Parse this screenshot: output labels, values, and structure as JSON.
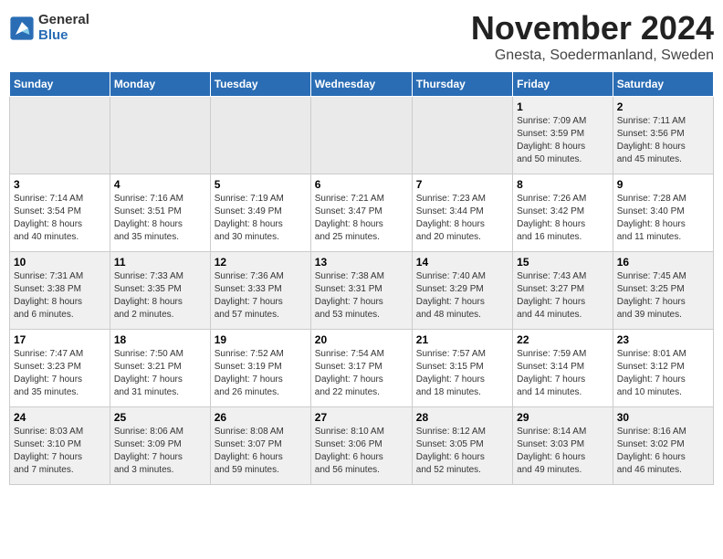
{
  "logo": {
    "general": "General",
    "blue": "Blue"
  },
  "title": "November 2024",
  "location": "Gnesta, Soedermanland, Sweden",
  "weekdays": [
    "Sunday",
    "Monday",
    "Tuesday",
    "Wednesday",
    "Thursday",
    "Friday",
    "Saturday"
  ],
  "weeks": [
    [
      {
        "day": "",
        "info": ""
      },
      {
        "day": "",
        "info": ""
      },
      {
        "day": "",
        "info": ""
      },
      {
        "day": "",
        "info": ""
      },
      {
        "day": "",
        "info": ""
      },
      {
        "day": "1",
        "info": "Sunrise: 7:09 AM\nSunset: 3:59 PM\nDaylight: 8 hours\nand 50 minutes."
      },
      {
        "day": "2",
        "info": "Sunrise: 7:11 AM\nSunset: 3:56 PM\nDaylight: 8 hours\nand 45 minutes."
      }
    ],
    [
      {
        "day": "3",
        "info": "Sunrise: 7:14 AM\nSunset: 3:54 PM\nDaylight: 8 hours\nand 40 minutes."
      },
      {
        "day": "4",
        "info": "Sunrise: 7:16 AM\nSunset: 3:51 PM\nDaylight: 8 hours\nand 35 minutes."
      },
      {
        "day": "5",
        "info": "Sunrise: 7:19 AM\nSunset: 3:49 PM\nDaylight: 8 hours\nand 30 minutes."
      },
      {
        "day": "6",
        "info": "Sunrise: 7:21 AM\nSunset: 3:47 PM\nDaylight: 8 hours\nand 25 minutes."
      },
      {
        "day": "7",
        "info": "Sunrise: 7:23 AM\nSunset: 3:44 PM\nDaylight: 8 hours\nand 20 minutes."
      },
      {
        "day": "8",
        "info": "Sunrise: 7:26 AM\nSunset: 3:42 PM\nDaylight: 8 hours\nand 16 minutes."
      },
      {
        "day": "9",
        "info": "Sunrise: 7:28 AM\nSunset: 3:40 PM\nDaylight: 8 hours\nand 11 minutes."
      }
    ],
    [
      {
        "day": "10",
        "info": "Sunrise: 7:31 AM\nSunset: 3:38 PM\nDaylight: 8 hours\nand 6 minutes."
      },
      {
        "day": "11",
        "info": "Sunrise: 7:33 AM\nSunset: 3:35 PM\nDaylight: 8 hours\nand 2 minutes."
      },
      {
        "day": "12",
        "info": "Sunrise: 7:36 AM\nSunset: 3:33 PM\nDaylight: 7 hours\nand 57 minutes."
      },
      {
        "day": "13",
        "info": "Sunrise: 7:38 AM\nSunset: 3:31 PM\nDaylight: 7 hours\nand 53 minutes."
      },
      {
        "day": "14",
        "info": "Sunrise: 7:40 AM\nSunset: 3:29 PM\nDaylight: 7 hours\nand 48 minutes."
      },
      {
        "day": "15",
        "info": "Sunrise: 7:43 AM\nSunset: 3:27 PM\nDaylight: 7 hours\nand 44 minutes."
      },
      {
        "day": "16",
        "info": "Sunrise: 7:45 AM\nSunset: 3:25 PM\nDaylight: 7 hours\nand 39 minutes."
      }
    ],
    [
      {
        "day": "17",
        "info": "Sunrise: 7:47 AM\nSunset: 3:23 PM\nDaylight: 7 hours\nand 35 minutes."
      },
      {
        "day": "18",
        "info": "Sunrise: 7:50 AM\nSunset: 3:21 PM\nDaylight: 7 hours\nand 31 minutes."
      },
      {
        "day": "19",
        "info": "Sunrise: 7:52 AM\nSunset: 3:19 PM\nDaylight: 7 hours\nand 26 minutes."
      },
      {
        "day": "20",
        "info": "Sunrise: 7:54 AM\nSunset: 3:17 PM\nDaylight: 7 hours\nand 22 minutes."
      },
      {
        "day": "21",
        "info": "Sunrise: 7:57 AM\nSunset: 3:15 PM\nDaylight: 7 hours\nand 18 minutes."
      },
      {
        "day": "22",
        "info": "Sunrise: 7:59 AM\nSunset: 3:14 PM\nDaylight: 7 hours\nand 14 minutes."
      },
      {
        "day": "23",
        "info": "Sunrise: 8:01 AM\nSunset: 3:12 PM\nDaylight: 7 hours\nand 10 minutes."
      }
    ],
    [
      {
        "day": "24",
        "info": "Sunrise: 8:03 AM\nSunset: 3:10 PM\nDaylight: 7 hours\nand 7 minutes."
      },
      {
        "day": "25",
        "info": "Sunrise: 8:06 AM\nSunset: 3:09 PM\nDaylight: 7 hours\nand 3 minutes."
      },
      {
        "day": "26",
        "info": "Sunrise: 8:08 AM\nSunset: 3:07 PM\nDaylight: 6 hours\nand 59 minutes."
      },
      {
        "day": "27",
        "info": "Sunrise: 8:10 AM\nSunset: 3:06 PM\nDaylight: 6 hours\nand 56 minutes."
      },
      {
        "day": "28",
        "info": "Sunrise: 8:12 AM\nSunset: 3:05 PM\nDaylight: 6 hours\nand 52 minutes."
      },
      {
        "day": "29",
        "info": "Sunrise: 8:14 AM\nSunset: 3:03 PM\nDaylight: 6 hours\nand 49 minutes."
      },
      {
        "day": "30",
        "info": "Sunrise: 8:16 AM\nSunset: 3:02 PM\nDaylight: 6 hours\nand 46 minutes."
      }
    ]
  ]
}
